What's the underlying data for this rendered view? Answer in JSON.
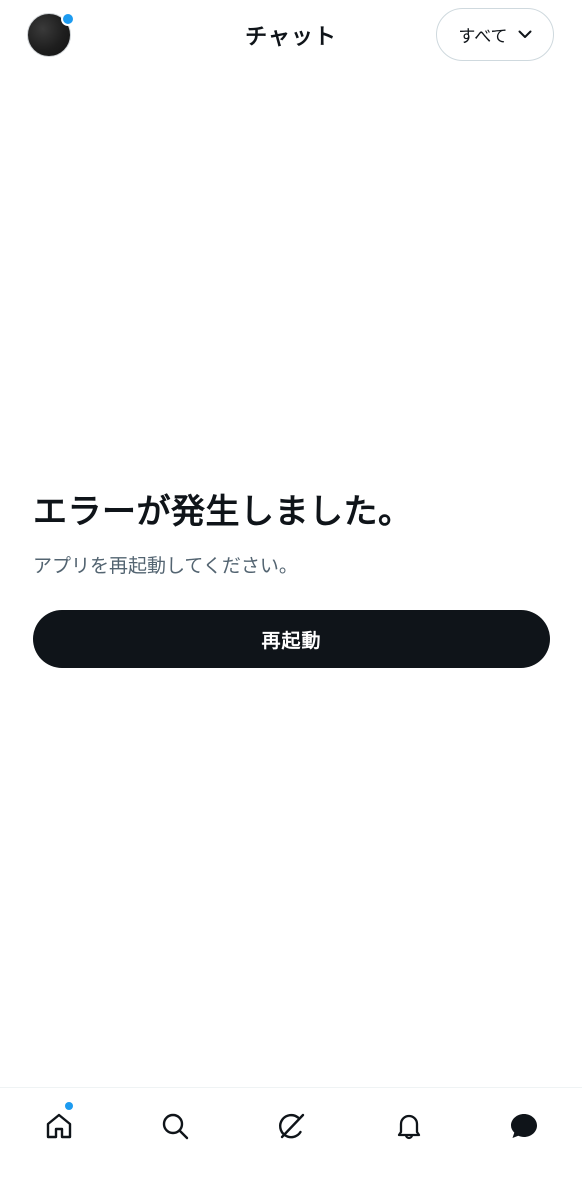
{
  "header": {
    "title": "チャット",
    "filter_label": "すべて",
    "avatar_has_notification": true
  },
  "error": {
    "title": "エラーが発生しました。",
    "message": "アプリを再起動してください。",
    "button_label": "再起動"
  },
  "bottom_nav": {
    "items": [
      {
        "icon": "home-icon",
        "active": false,
        "has_dot": true
      },
      {
        "icon": "search-icon",
        "active": false,
        "has_dot": false
      },
      {
        "icon": "grok-icon",
        "active": false,
        "has_dot": false
      },
      {
        "icon": "bell-icon",
        "active": false,
        "has_dot": false
      },
      {
        "icon": "chat-icon",
        "active": true,
        "has_dot": false
      }
    ]
  },
  "colors": {
    "text_primary": "#0f1419",
    "text_secondary": "#536471",
    "accent_blue": "#1d9bf0",
    "button_bg": "#0f1419",
    "border": "#cfd9de"
  }
}
